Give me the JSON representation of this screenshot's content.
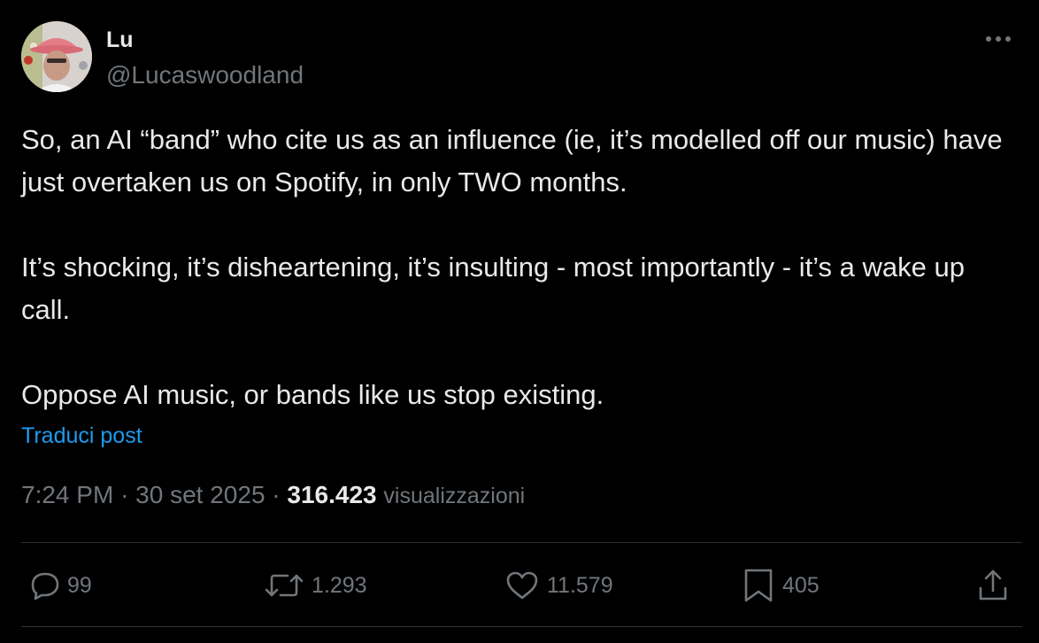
{
  "author": {
    "name": "Lu",
    "handle": "@Lucaswoodland"
  },
  "post": {
    "paragraphs": [
      "So, an AI “band” who cite us as an influence (ie, it’s modelled off our music) have just overtaken us on Spotify, in only TWO months.",
      "It’s shocking, it’s disheartening, it’s insulting - most importantly - it’s a wake up call.",
      "Oppose AI music, or bands like us stop existing."
    ],
    "translate_label": "Traduci post"
  },
  "meta": {
    "time": "7:24 PM",
    "separator": "·",
    "date": "30 set 2025",
    "views_count": "316.423",
    "views_label": "visualizzazioni"
  },
  "actions": {
    "reply_count": "99",
    "retweet_count": "1.293",
    "like_count": "11.579",
    "bookmark_count": "405"
  },
  "icons": {
    "more": "more-horizontal-icon",
    "reply": "speech-bubble-icon",
    "retweet": "retweet-icon",
    "like": "heart-icon",
    "bookmark": "bookmark-icon",
    "share": "share-upload-icon"
  },
  "colors": {
    "background": "#000000",
    "text_primary": "#e7e9ea",
    "text_secondary": "#71767b",
    "link": "#1d9bf0",
    "divider": "#2f3336"
  }
}
